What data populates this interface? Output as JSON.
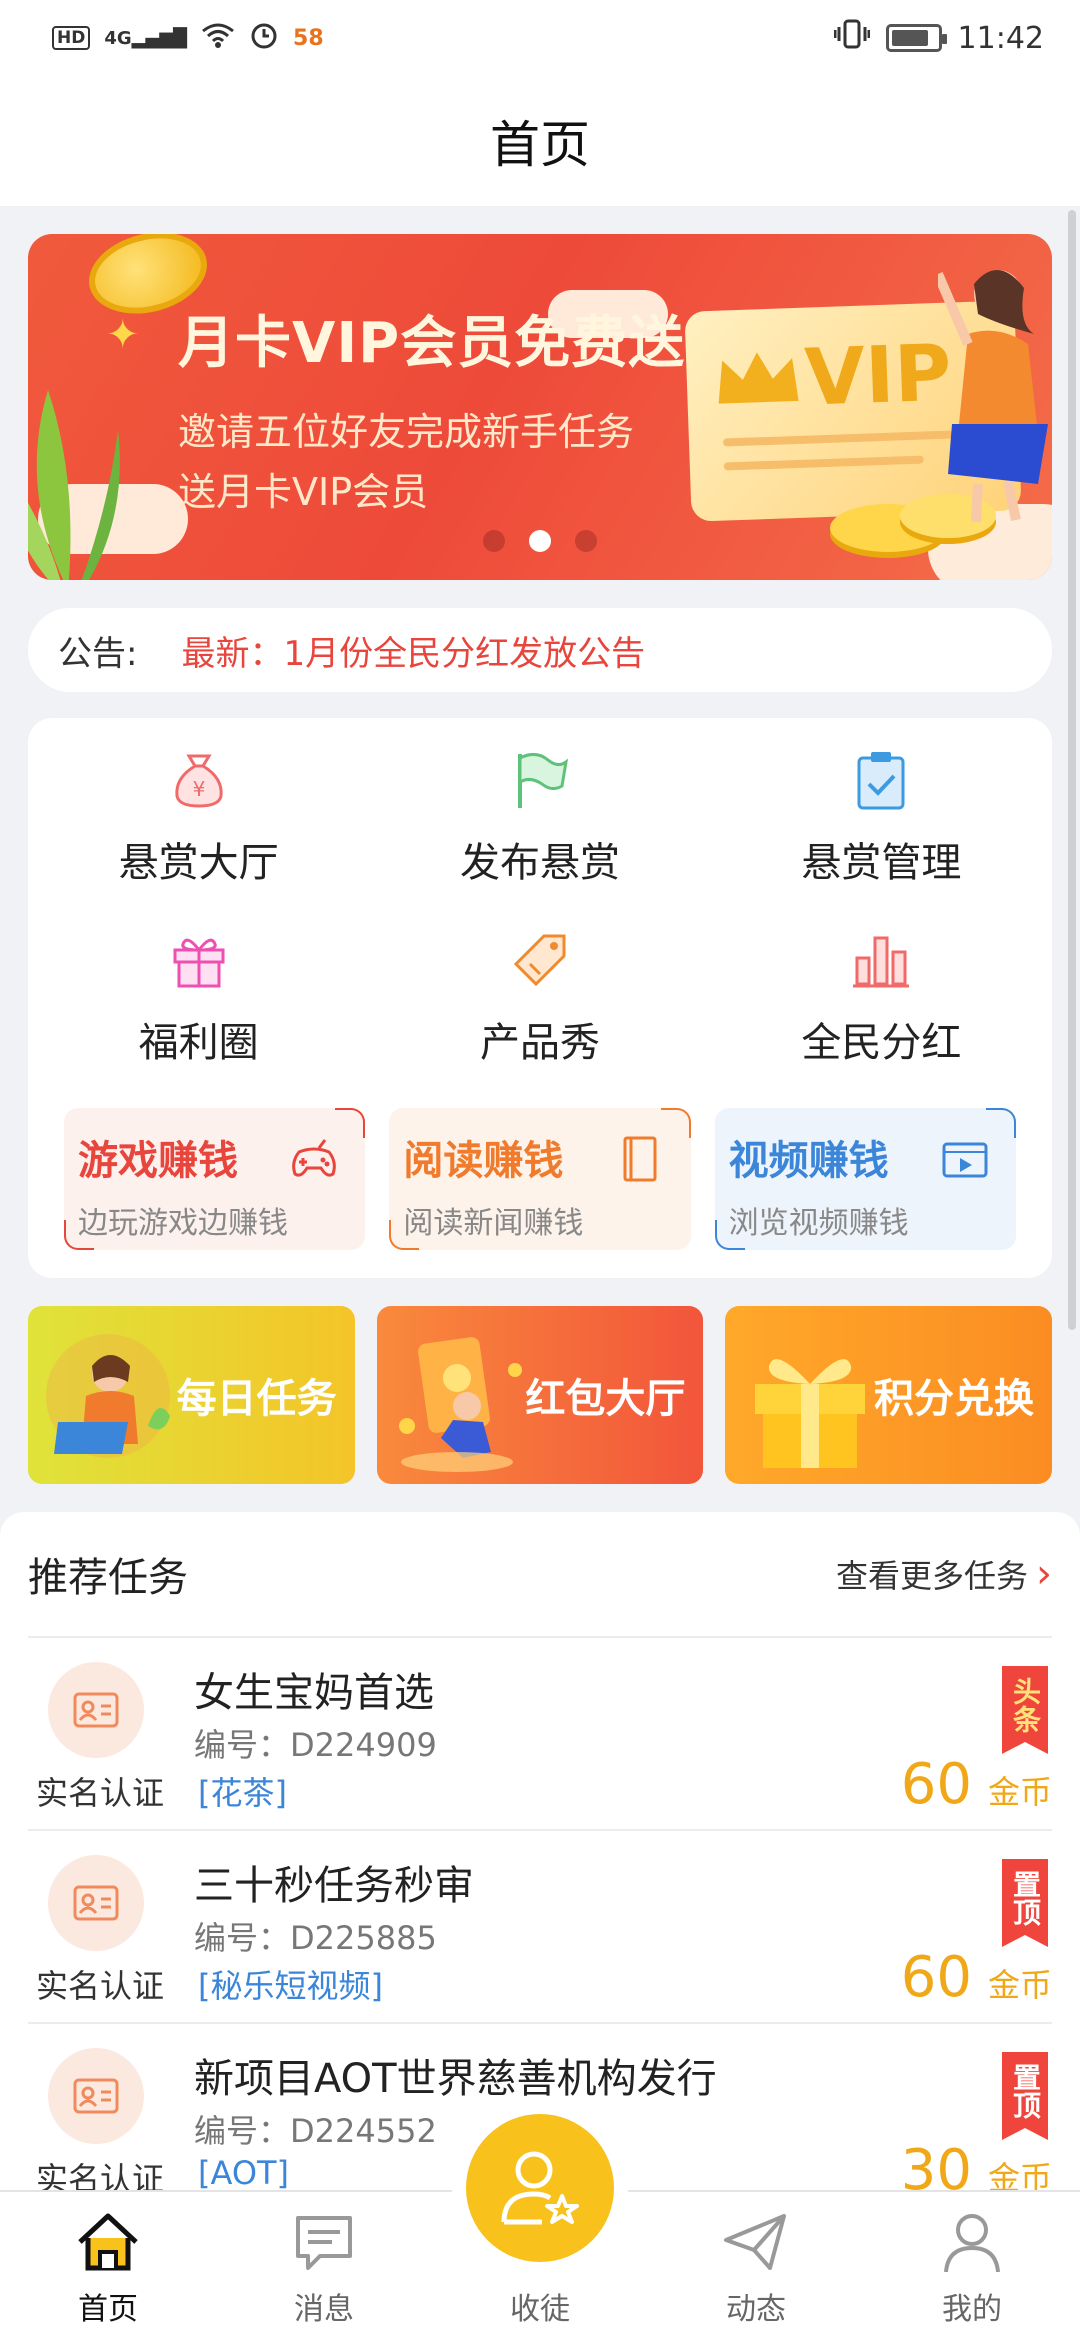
{
  "status_bar": {
    "hd": "HD",
    "network": "4G",
    "badge": "58",
    "time": "11:42"
  },
  "header": {
    "title": "首页"
  },
  "banner": {
    "title": "月卡VIP会员免费送",
    "line1": "邀请五位好友完成新手任务",
    "line2": "送月卡VIP会员",
    "card_text": "VIP",
    "dots": 3,
    "active_dot": 2
  },
  "notice": {
    "label": "公告:",
    "text": "最新：1月份全民分红发放公告"
  },
  "grid": [
    {
      "label": "悬赏大厅",
      "icon": "money-bag-icon"
    },
    {
      "label": "发布悬赏",
      "icon": "flag-icon"
    },
    {
      "label": "悬赏管理",
      "icon": "clipboard-check-icon"
    },
    {
      "label": "福利圈",
      "icon": "gift-icon"
    },
    {
      "label": "产品秀",
      "icon": "tag-icon"
    },
    {
      "label": "全民分红",
      "icon": "bar-chart-icon"
    }
  ],
  "earn": [
    {
      "title": "游戏赚钱",
      "subtitle": "边玩游戏边赚钱",
      "color": "#e8453c",
      "bg": "#fdf1ee",
      "icon": "gamepad-icon"
    },
    {
      "title": "阅读赚钱",
      "subtitle": "阅读新闻赚钱",
      "color": "#f07b2c",
      "bg": "#fdf3ea",
      "icon": "book-icon"
    },
    {
      "title": "视频赚钱",
      "subtitle": "浏览视频赚钱",
      "color": "#3b86d8",
      "bg": "#eef4fb",
      "icon": "video-icon"
    }
  ],
  "promos": [
    {
      "label": "每日任务",
      "colors": [
        "#e9dc2f",
        "#f3c12a"
      ]
    },
    {
      "label": "红包大厅",
      "colors": [
        "#f98a3c",
        "#f2553b"
      ]
    },
    {
      "label": "积分兑换",
      "colors": [
        "#ffa92a",
        "#fb8c22"
      ]
    }
  ],
  "tasks": {
    "title": "推荐任务",
    "more": "查看更多任务",
    "items": [
      {
        "title": "女生宝妈首选",
        "id": "编号：D224909",
        "verify": "实名认证",
        "tag": "[花茶]",
        "flag": "头条",
        "flag_type": "headline",
        "coins": "60",
        "unit": "金币"
      },
      {
        "title": "三十秒任务秒审",
        "id": "编号：D225885",
        "verify": "实名认证",
        "tag": "[秘乐短视频]",
        "flag": "置顶",
        "flag_type": "pin",
        "coins": "60",
        "unit": "金币"
      },
      {
        "title": "新项目AOT世界慈善机构发行",
        "id": "编号：D224552",
        "verify": "实名认证",
        "tag": "[AOT]",
        "flag": "置顶",
        "flag_type": "pin",
        "coins": "30",
        "unit": "金币"
      }
    ]
  },
  "nav": [
    {
      "label": "首页",
      "icon": "home-icon",
      "active": true
    },
    {
      "label": "消息",
      "icon": "message-icon",
      "active": false
    },
    {
      "label": "收徒",
      "icon": "recruit-icon",
      "active": false
    },
    {
      "label": "动态",
      "icon": "paper-plane-icon",
      "active": false
    },
    {
      "label": "我的",
      "icon": "profile-icon",
      "active": false
    }
  ]
}
